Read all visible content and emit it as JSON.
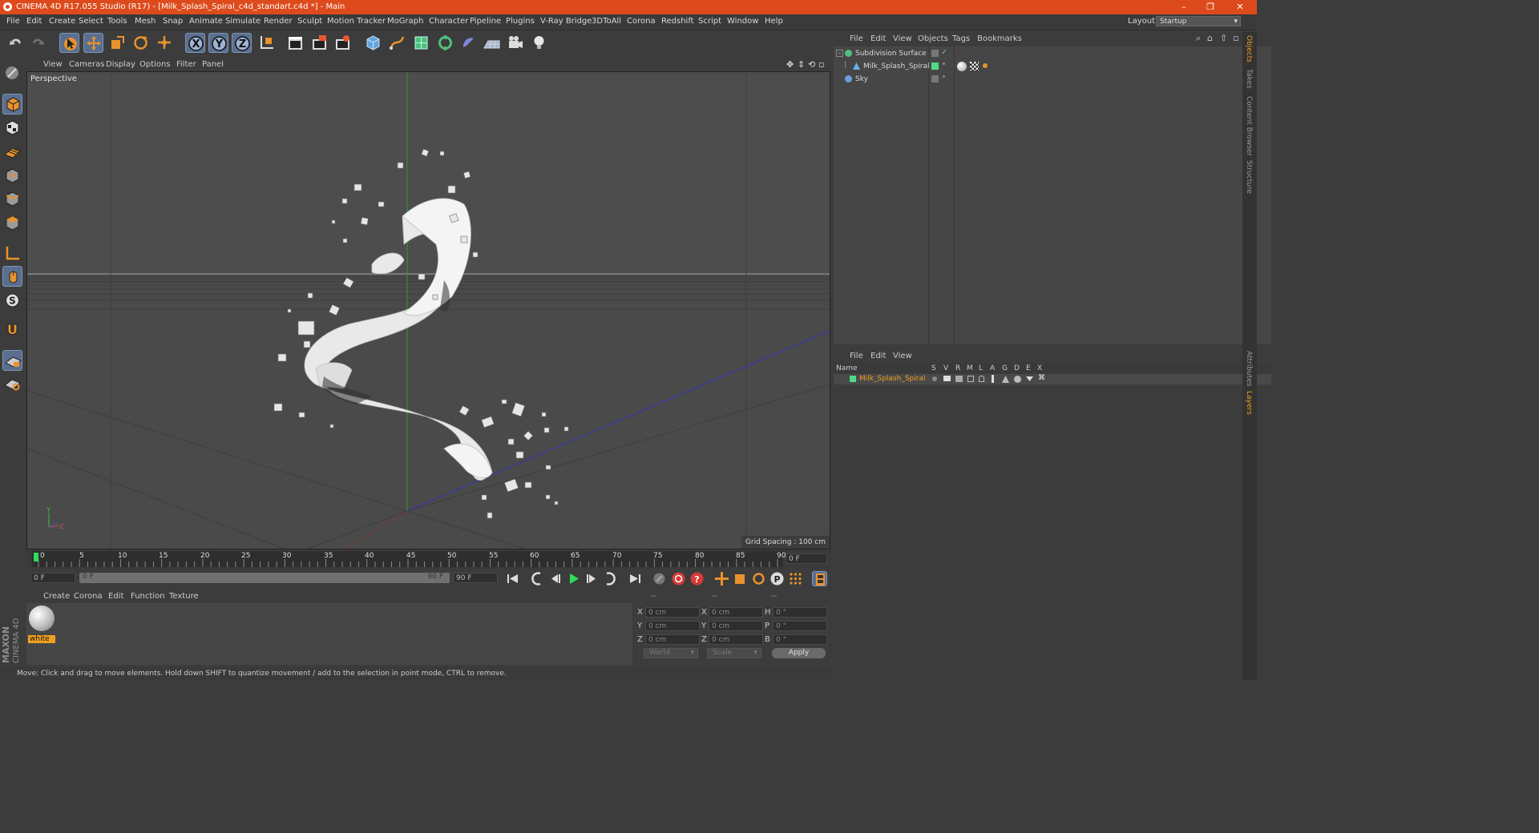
{
  "titlebar": {
    "title": "CINEMA 4D R17.055 Studio (R17) - [Milk_Splash_Spiral_c4d_standart.c4d *] - Main",
    "minimize": "–",
    "restore": "❐",
    "close": "✕"
  },
  "menubar": {
    "items": [
      "File",
      "Edit",
      "Create",
      "Select",
      "Tools",
      "Mesh",
      "Snap",
      "Animate",
      "Simulate",
      "Render",
      "Sculpt",
      "Motion Tracker",
      "MoGraph",
      "Character",
      "Pipeline",
      "Plugins",
      "V-Ray Bridge",
      "3DToAll",
      "Corona",
      "Redshift",
      "Script",
      "Window",
      "Help"
    ],
    "layout_label": "Layout:",
    "layout_value": "Startup"
  },
  "toolbar": {
    "icons": [
      "undo-icon",
      "redo-icon",
      "select-cursor-icon",
      "move-icon",
      "scale-icon",
      "rotate-icon",
      "transform-icon",
      "x-axis-icon",
      "y-axis-icon",
      "z-axis-icon",
      "coordinate-system-icon",
      "render-view-icon",
      "render-picture-viewer-icon",
      "render-settings-icon",
      "cube-object-icon",
      "pen-spline-icon",
      "subdivision-icon",
      "array-icon",
      "deformer-icon",
      "floor-icon",
      "camera-icon",
      "light-icon"
    ],
    "axis_labels": [
      "X",
      "Y",
      "Z"
    ]
  },
  "viewport": {
    "menu": [
      "View",
      "Cameras",
      "Display",
      "Options",
      "Filter",
      "Panel"
    ],
    "label": "Perspective",
    "grid_spacing": "Grid Spacing : 100 cm",
    "axis_y": "Y",
    "axis_z": "Z"
  },
  "timeline": {
    "ticks": [
      "0",
      "5",
      "10",
      "15",
      "20",
      "25",
      "30",
      "35",
      "40",
      "45",
      "50",
      "55",
      "60",
      "65",
      "70",
      "75",
      "80",
      "85",
      "90"
    ],
    "current_frame": "0 F",
    "start": "0 F",
    "range_start": "0 F",
    "range_end": "90 F",
    "end": "90 F"
  },
  "materials": {
    "menu": [
      "Create",
      "Corona",
      "Edit",
      "Function",
      "Texture"
    ],
    "items": [
      {
        "name": "white"
      }
    ],
    "brand": "MAXON",
    "brand2": "CINEMA 4D"
  },
  "coords": {
    "headers": [
      "--",
      "--",
      "--"
    ],
    "rows": [
      {
        "a": "X",
        "av": "0 cm",
        "b": "X",
        "bv": "0 cm",
        "c": "H",
        "cv": "0 °"
      },
      {
        "a": "Y",
        "av": "0 cm",
        "b": "Y",
        "bv": "0 cm",
        "c": "P",
        "cv": "0 °"
      },
      {
        "a": "Z",
        "av": "0 cm",
        "b": "Z",
        "bv": "0 cm",
        "c": "B",
        "cv": "0 °"
      }
    ],
    "world": "World",
    "scale": "Scale",
    "apply": "Apply"
  },
  "status": {
    "text": "Move: Click and drag to move elements. Hold down SHIFT to quantize movement / add to the selection in point mode, CTRL to remove."
  },
  "object_manager": {
    "menu": [
      "File",
      "Edit",
      "View",
      "Objects",
      "Tags",
      "Bookmarks"
    ],
    "objects": [
      {
        "name": "Subdivision Surface"
      },
      {
        "name": "Milk_Splash_Spiral"
      },
      {
        "name": "Sky"
      }
    ]
  },
  "layer_manager": {
    "menu": [
      "File",
      "Edit",
      "View"
    ],
    "columns": [
      "Name",
      "S",
      "V",
      "R",
      "M",
      "L",
      "A",
      "G",
      "D",
      "E",
      "X"
    ],
    "layers": [
      {
        "name": "Milk_Splash_Spiral",
        "color": "#4fd98a"
      }
    ]
  },
  "right_tabs": [
    "Objects",
    "Takes",
    "Content Browser",
    "Structure",
    "Attributes",
    "Layers"
  ],
  "colors": {
    "accent": "#dd4b1c",
    "selection": "#5a6f8f",
    "layer_text": "#f0a020"
  }
}
